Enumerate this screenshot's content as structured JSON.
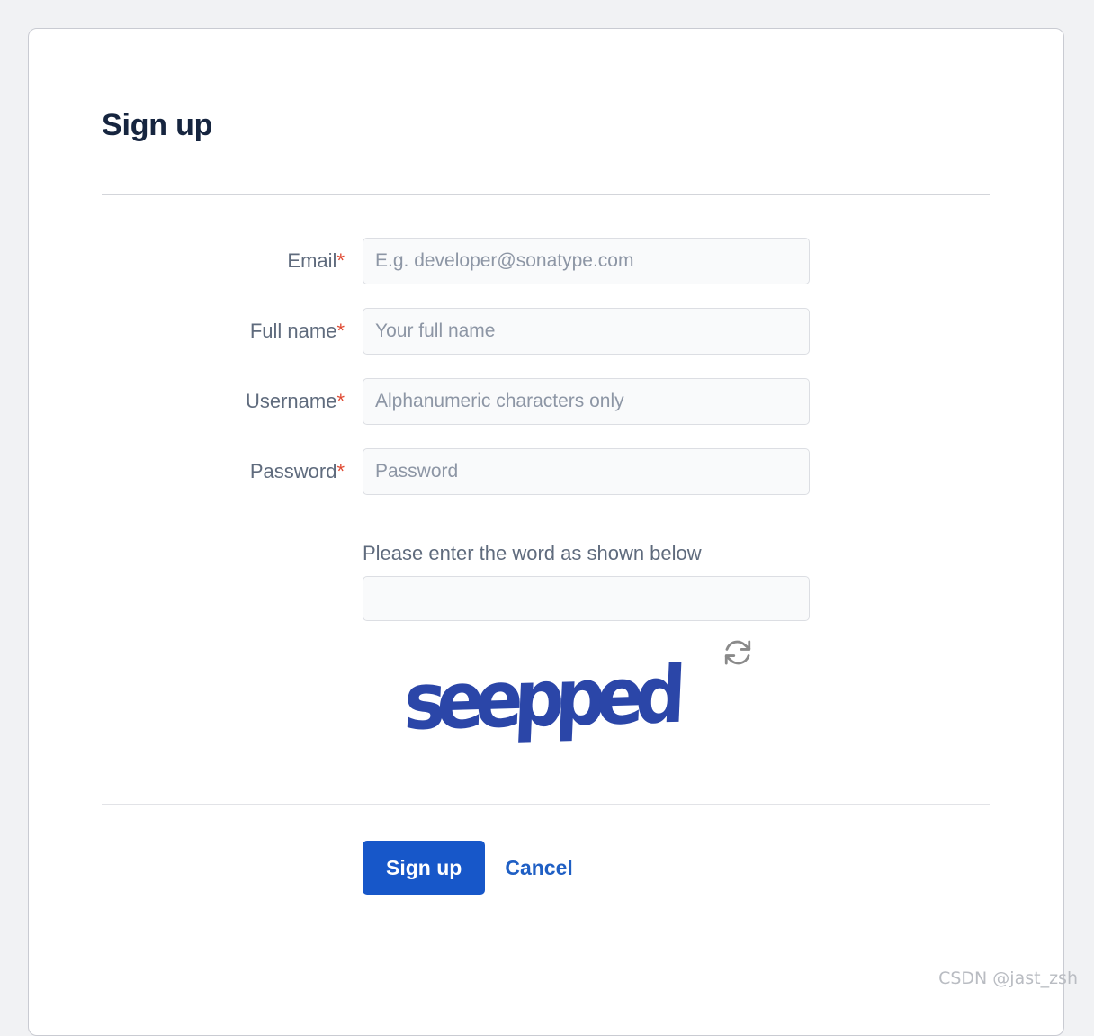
{
  "page": {
    "title": "Sign up",
    "watermark": "CSDN @jast_zsh",
    "background_color": "#f1f2f4",
    "card_color": "#ffffff",
    "accent_color": "#1757c9",
    "required_color": "#e04a32",
    "label_color": "#5f6b7d",
    "title_color": "#16253f"
  },
  "form": {
    "fields": [
      {
        "name": "email",
        "label": "Email",
        "required_mark": "*",
        "value": "",
        "placeholder": "E.g. developer@sonatype.com",
        "type": "text"
      },
      {
        "name": "full-name",
        "label": "Full name",
        "required_mark": "*",
        "value": "",
        "placeholder": "Your full name",
        "type": "text"
      },
      {
        "name": "username",
        "label": "Username",
        "required_mark": "*",
        "value": "",
        "placeholder": "Alphanumeric characters only",
        "type": "text"
      },
      {
        "name": "password",
        "label": "Password",
        "required_mark": "*",
        "value": "",
        "placeholder": "Password",
        "type": "password"
      }
    ]
  },
  "captcha": {
    "prompt": "Please enter the word as shown below",
    "input_value": "",
    "input_placeholder": "",
    "word": "seepped",
    "word_color": "#2b46a8",
    "refresh_icon": "refresh-icon"
  },
  "actions": {
    "submit_label": "Sign up",
    "cancel_label": "Cancel",
    "submit_color": "#1757c9",
    "cancel_color": "#1f5fc4"
  }
}
